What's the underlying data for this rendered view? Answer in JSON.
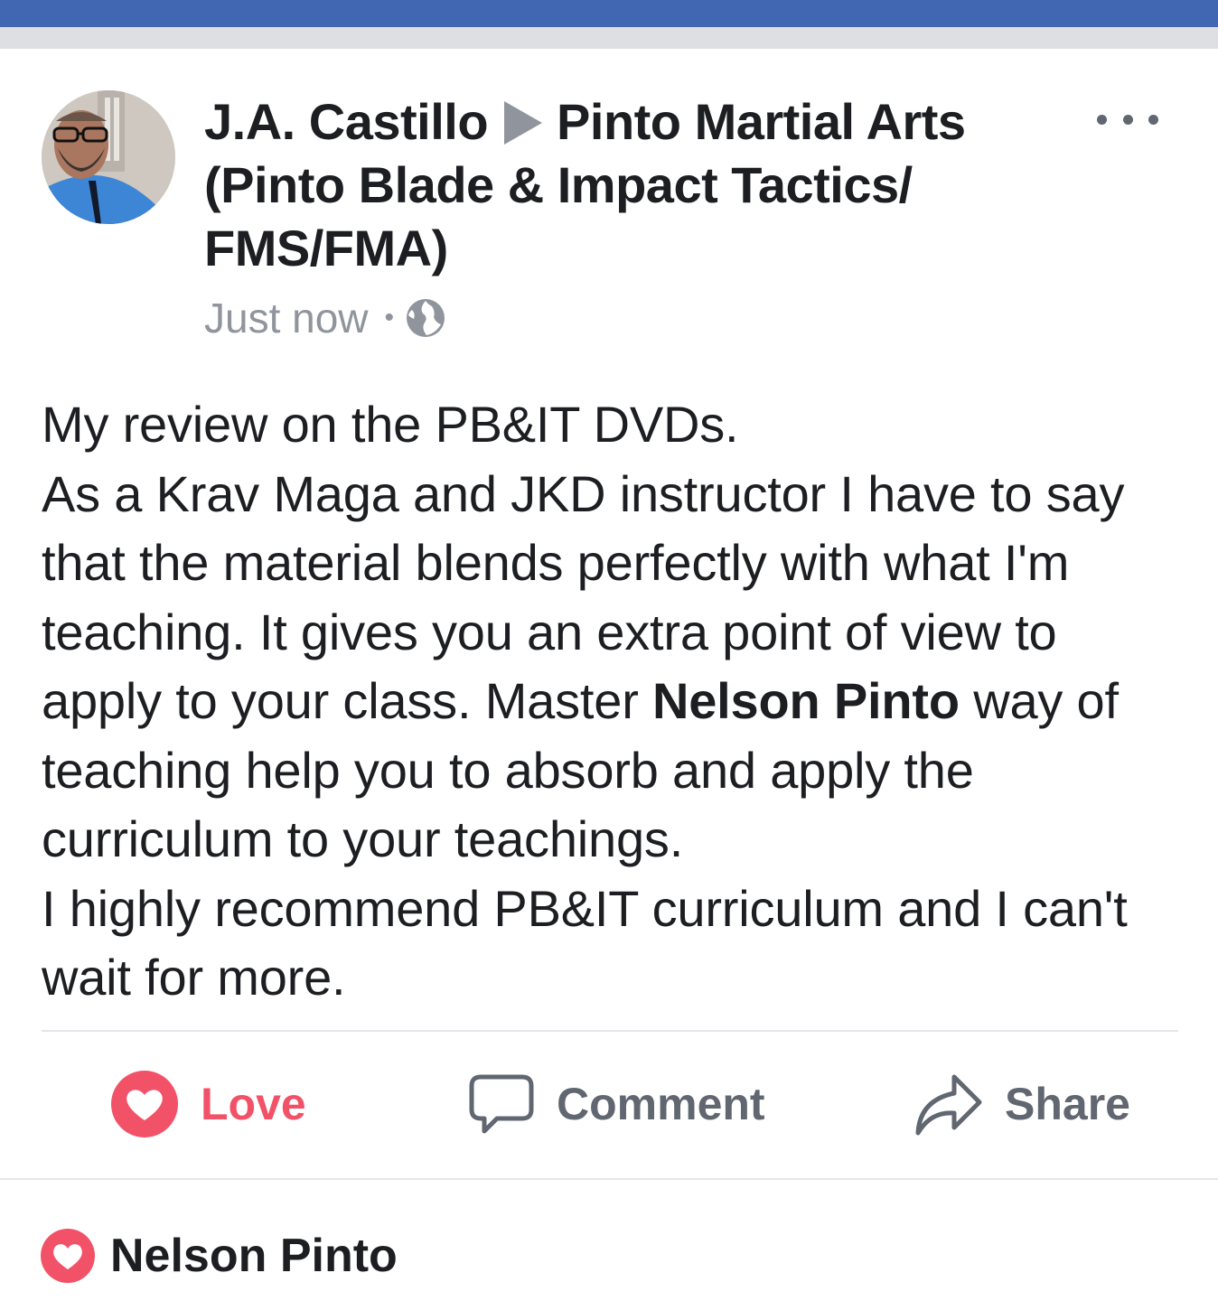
{
  "post": {
    "author": "J.A. Castillo",
    "target": "Pinto Martial Arts (Pinto Blade & Impact Tactics/ FMS/FMA)",
    "time": "Just now",
    "separator": "•",
    "privacy_icon": "globe-icon",
    "more_icon": "more-options-icon",
    "body": {
      "line_1": "My review on the PB&IT DVDs.",
      "para_2_before": "As a Krav Maga and JKD instructor I have to say that the material blends perfectly with what I'm teaching. It gives you an extra point of view to apply to your class. Master ",
      "mention": "Nelson Pinto",
      "para_2_after": " way of teaching help you to absorb and apply the curriculum to your teachings.",
      "line_3": "I highly recommend PB&IT curriculum and I can't wait for more."
    }
  },
  "actions": {
    "love": {
      "label": "Love",
      "icon": "heart-icon",
      "color": "#f25268"
    },
    "comment": {
      "label": "Comment",
      "icon": "comment-bubble-icon"
    },
    "share": {
      "label": "Share",
      "icon": "share-arrow-icon"
    }
  },
  "reactions": {
    "name": "Nelson Pinto",
    "icon": "heart-icon"
  },
  "colors": {
    "brand_bar": "#4267b2",
    "love_red": "#f25268",
    "muted_gray": "#90949c"
  }
}
